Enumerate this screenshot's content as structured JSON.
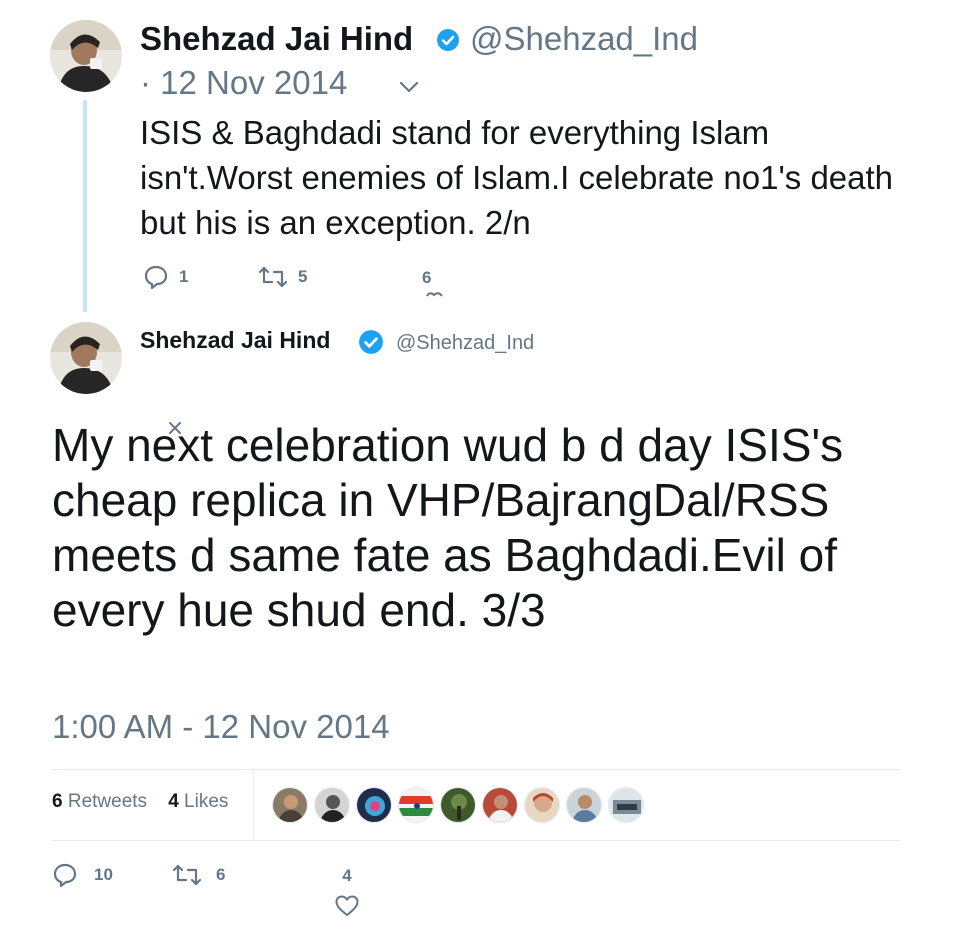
{
  "tweet1": {
    "name": "Shehzad Jai Hind",
    "handle": "@Shehzad_Ind",
    "date": "· 12 Nov 2014",
    "text": "ISIS & Baghdadi stand for everything Islam isn't.Worst enemies of Islam.I celebrate no1's death but his is an exception. 2/n",
    "replies": "1",
    "retweets": "5",
    "likes": "6"
  },
  "tweet2": {
    "name": "Shehzad Jai Hind",
    "handle": "@Shehzad_Ind",
    "text": "My next celebration wud b d day ISIS's cheap replica in VHP/BajrangDal/RSS meets d same fate as Baghdadi.Evil of every hue shud end. 3/3",
    "timestamp": "1:00 AM - 12 Nov 2014",
    "retweet_count": "6",
    "retweet_label": "Retweets",
    "like_count": "4",
    "like_label": "Likes",
    "replies": "10",
    "retweets": "6",
    "likes": "4"
  },
  "colors": {
    "verified": "#1da1f2",
    "secondary_text": "#657786",
    "thread_line": "#c4e5f9"
  },
  "icons": [
    "verified-badge-icon",
    "chevron-down-icon",
    "reply-icon",
    "retweet-icon",
    "like-icon",
    "close-icon"
  ]
}
